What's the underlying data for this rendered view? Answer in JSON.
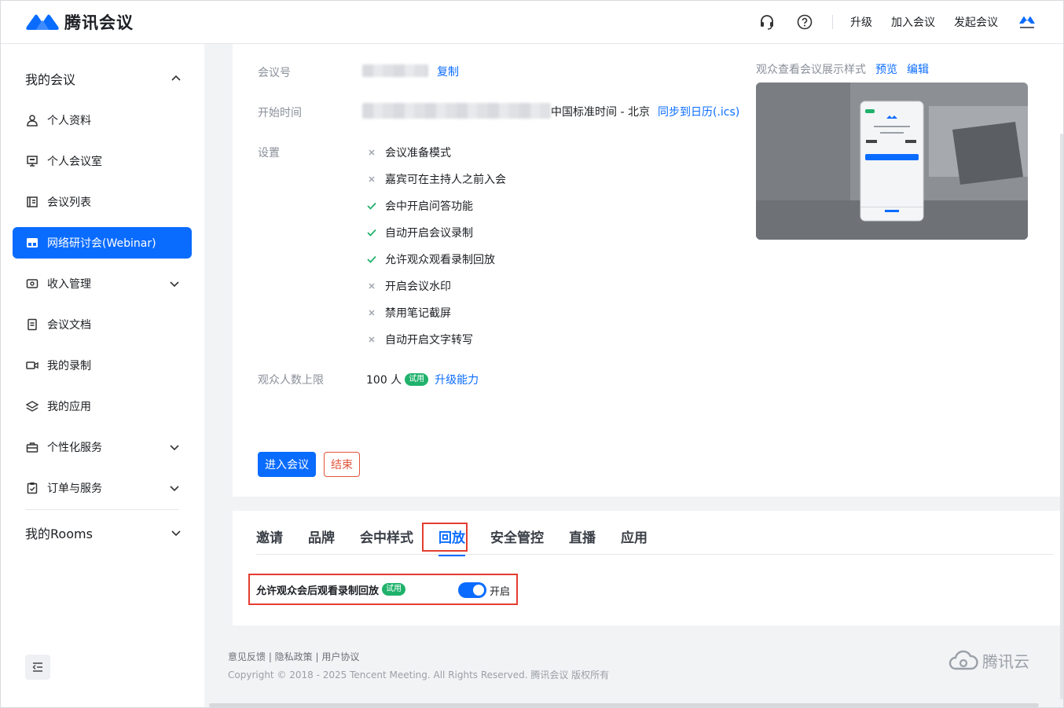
{
  "header": {
    "app_name": "腾讯会议",
    "links": [
      "升级",
      "加入会议",
      "发起会议"
    ],
    "avatar_caption": "腾讯会议"
  },
  "sidebar": {
    "group_my_meetings": "我的会议",
    "items": [
      {
        "label": "个人资料",
        "icon": "user-icon"
      },
      {
        "label": "个人会议室",
        "icon": "monitor-icon"
      },
      {
        "label": "会议列表",
        "icon": "list-icon"
      },
      {
        "label": "网络研讨会(Webinar)",
        "icon": "webinar-icon",
        "active": true
      },
      {
        "label": "收入管理",
        "icon": "wallet-icon",
        "expandable": true
      },
      {
        "label": "会议文档",
        "icon": "document-icon"
      },
      {
        "label": "我的录制",
        "icon": "video-icon"
      },
      {
        "label": "我的应用",
        "icon": "layers-icon"
      },
      {
        "label": "个性化服务",
        "icon": "briefcase-icon",
        "expandable": true
      },
      {
        "label": "订单与服务",
        "icon": "clipboard-icon",
        "expandable": true
      }
    ],
    "group_rooms": "我的Rooms"
  },
  "meeting": {
    "id_label": "会议号",
    "copy_link": "复制",
    "start_label": "开始时间",
    "timezone": "中国标准时间 - 北京",
    "sync_calendar": "同步到日历(.ics)",
    "settings_label": "设置",
    "settings": [
      {
        "label": "会议准备模式",
        "enabled": false
      },
      {
        "label": "嘉宾可在主持人之前入会",
        "enabled": false
      },
      {
        "label": "会中开启问答功能",
        "enabled": true
      },
      {
        "label": "自动开启会议录制",
        "enabled": true
      },
      {
        "label": "允许观众观看录制回放",
        "enabled": true
      },
      {
        "label": "开启会议水印",
        "enabled": false
      },
      {
        "label": "禁用笔记截屏",
        "enabled": false
      },
      {
        "label": "自动开启文字转写",
        "enabled": false
      }
    ],
    "audience_label": "观众人数上限",
    "audience_value": "100 人",
    "trial_tag": "试用",
    "upgrade_link": "升级能力",
    "enter_button": "进入会议",
    "end_button": "结束"
  },
  "preview": {
    "title": "观众查看会议展示样式",
    "preview_link": "预览",
    "edit_link": "编辑"
  },
  "tabs": {
    "items": [
      "邀请",
      "品牌",
      "会中样式",
      "回放",
      "安全管控",
      "直播",
      "应用"
    ],
    "active": "回放"
  },
  "replay": {
    "label": "允许观众会后观看录制回放",
    "trial_tag": "试用",
    "toggle_on": true,
    "toggle_text": "开启"
  },
  "footer": {
    "links": "意见反馈 | 隐私政策 | 用户协议",
    "copyright": "Copyright © 2018 - 2025 Tencent Meeting. All Rights Reserved. 腾讯会议 版权所有",
    "brand": "腾讯云"
  },
  "colors": {
    "accent": "#0a6cff",
    "success": "#1fb26b",
    "danger": "#e2543b",
    "highlight": "#e43d30"
  }
}
